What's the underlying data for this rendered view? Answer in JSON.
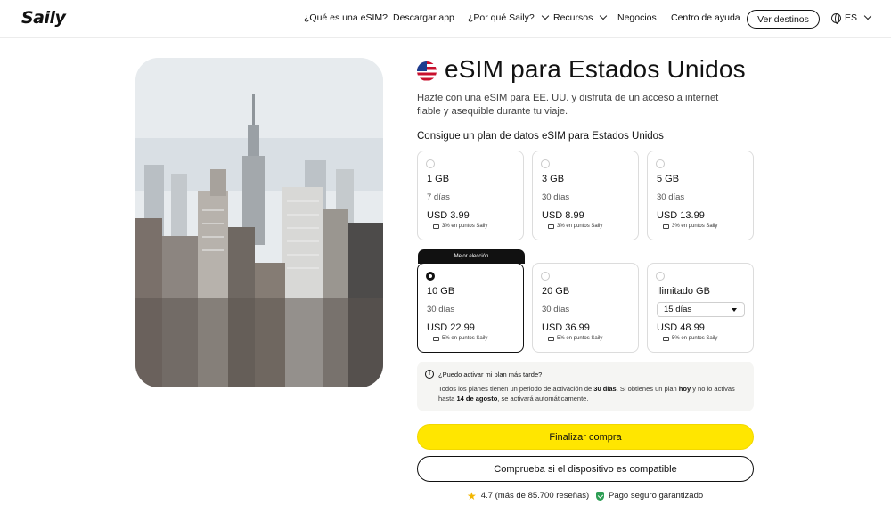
{
  "header": {
    "logo": "Saily",
    "nav": [
      {
        "label": "¿Qué es una eSIM?",
        "dropdown": false
      },
      {
        "label": "Descargar app",
        "dropdown": false
      },
      {
        "label": "¿Por qué Saily?",
        "dropdown": true
      },
      {
        "label": "Recursos",
        "dropdown": true
      },
      {
        "label": "Negocios",
        "dropdown": false
      },
      {
        "label": "Centro de ayuda",
        "dropdown": false
      }
    ],
    "cta": "Ver destinos",
    "language": "ES"
  },
  "hero": {
    "icon": "us-flag-icon",
    "title": "eSIM para Estados Unidos",
    "subtitle": "Hazte con una eSIM para EE. UU. y disfruta de un acceso a internet fiable y asequible durante tu viaje."
  },
  "plans_section": {
    "title": "Consigue un plan de datos eSIM para Estados Unidos",
    "plans": [
      {
        "gb": "1 GB",
        "days": "7 días",
        "price": "USD 3.99",
        "points": "3% en puntos Saily",
        "selected": false
      },
      {
        "gb": "3 GB",
        "days": "30 días",
        "price": "USD 8.99",
        "points": "3% en puntos Saily",
        "selected": false
      },
      {
        "gb": "5 GB",
        "days": "30 días",
        "price": "USD 13.99",
        "points": "3% en puntos Saily",
        "selected": false
      },
      {
        "gb": "10 GB",
        "days": "30 días",
        "price": "USD 22.99",
        "points": "5% en puntos Saily",
        "selected": true,
        "badge": "Mejor elección"
      },
      {
        "gb": "20 GB",
        "days": "30 días",
        "price": "USD 36.99",
        "points": "5% en puntos Saily",
        "selected": false
      },
      {
        "gb": "Ilimitado GB",
        "days_select": "15 días",
        "price": "USD 48.99",
        "points": "5% en puntos Saily",
        "selected": false
      }
    ]
  },
  "info": {
    "question": "¿Puedo activar mi plan más tarde?",
    "body_1": "Todos los planes tienen un periodo de activación de ",
    "body_bold_1": "30 días",
    "body_2": ". Si obtienes un plan ",
    "body_bold_2": "hoy",
    "body_3": " y no lo activas hasta ",
    "body_bold_3": "14 de agosto",
    "body_4": ", se activará automáticamente."
  },
  "actions": {
    "primary": "Finalizar compra",
    "secondary": "Comprueba si el dispositivo es compatible"
  },
  "trust": {
    "rating": "4.7 (más de 85.700 reseñas)",
    "secure": "Pago seguro garantizado"
  },
  "colors": {
    "accent": "#ffe600",
    "text": "#111111",
    "success": "#2e9e55"
  }
}
